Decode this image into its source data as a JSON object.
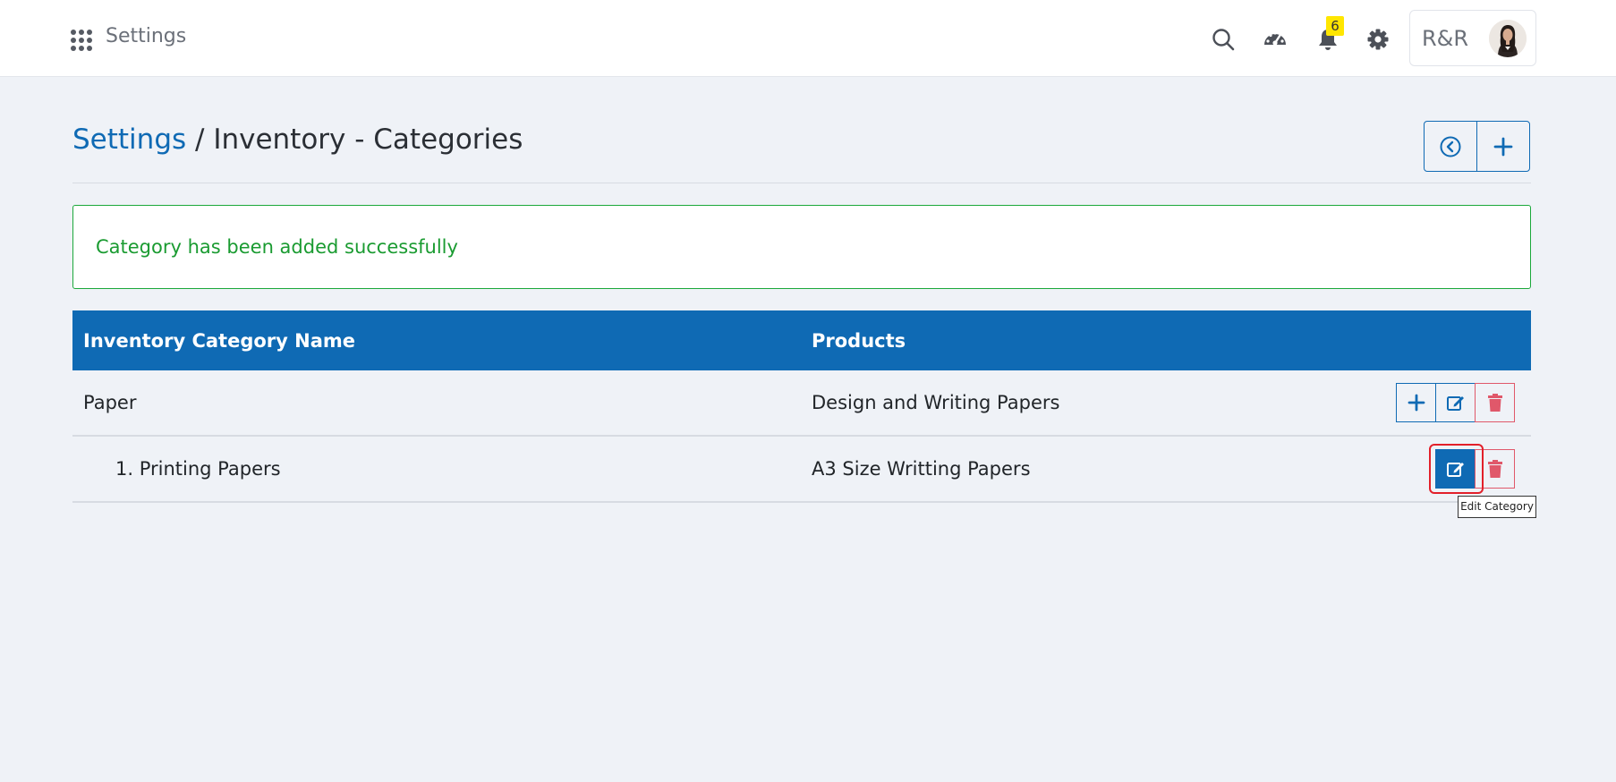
{
  "header": {
    "app_title": "Settings",
    "notifications_count": "6",
    "user_initials": "R&R",
    "icons": [
      "apps-grid-icon",
      "search-icon",
      "dashboard-gauge-icon",
      "bell-icon",
      "gear-icon"
    ]
  },
  "breadcrumb": {
    "root": "Settings",
    "separator": " / ",
    "current": "Inventory - Categories"
  },
  "alert": {
    "message": "Category has been added successfully"
  },
  "table": {
    "columns": [
      "Inventory Category Name",
      "Products"
    ],
    "rows": [
      {
        "name": "Paper",
        "products": "Design and Writing Papers"
      },
      {
        "name": "1. Printing Papers",
        "products": "A3 Size Writting Papers"
      }
    ]
  },
  "tooltip": "Edit Category",
  "colors": {
    "primary": "#0f6ab4",
    "success": "#1ba83a",
    "danger": "#e0586a",
    "background": "#eff2f7",
    "badge": "#ffe600"
  }
}
